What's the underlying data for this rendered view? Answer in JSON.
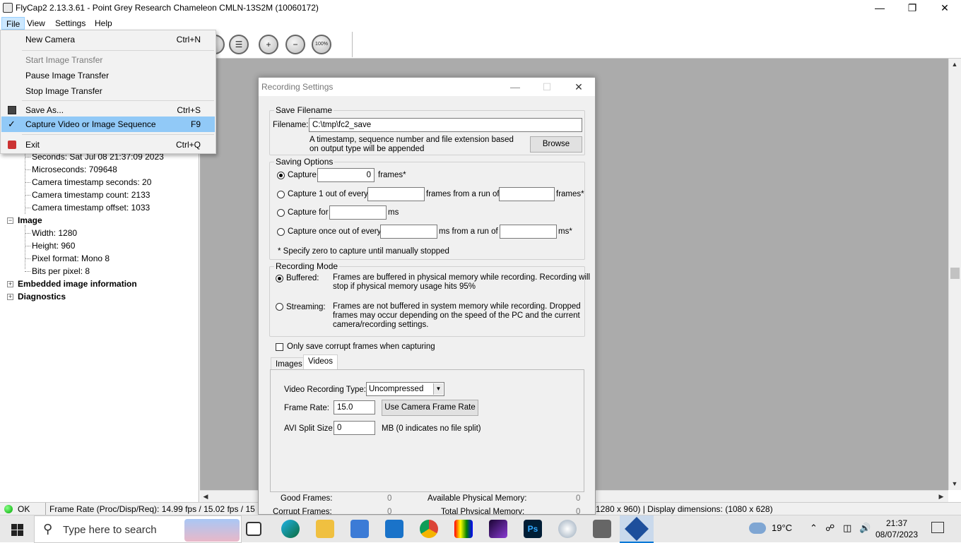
{
  "window": {
    "title": "FlyCap2 2.13.3.61 - Point Grey Research Chameleon CMLN-13S2M (10060172)"
  },
  "menubar": {
    "items": [
      "File",
      "View",
      "Settings",
      "Help"
    ]
  },
  "file_menu": {
    "new_camera": {
      "label": "New Camera",
      "shortcut": "Ctrl+N"
    },
    "start_transfer": {
      "label": "Start Image Transfer"
    },
    "pause_transfer": {
      "label": "Pause Image Transfer"
    },
    "stop_transfer": {
      "label": "Stop Image Transfer"
    },
    "save_as": {
      "label": "Save As...",
      "shortcut": "Ctrl+S"
    },
    "capture": {
      "label": "Capture Video or Image Sequence",
      "shortcut": "F9"
    },
    "exit": {
      "label": "Exit",
      "shortcut": "Ctrl+Q"
    }
  },
  "toolbar": {
    "zoom_100_label": "100%"
  },
  "tree": {
    "timestamp_items": [
      "Seconds: Sat Jul 08 21:37:09 2023",
      "Microseconds: 709648",
      "Camera timestamp seconds: 20",
      "Camera timestamp count:  2133",
      "Camera timestamp offset: 1033"
    ],
    "image_node": "Image",
    "image_items": [
      "Width: 1280",
      "Height: 960",
      "Pixel format: Mono 8",
      "Bits per pixel:  8"
    ],
    "embedded_node": "Embedded image information",
    "diagnostics_node": "Diagnostics"
  },
  "statusbar": {
    "ok": "OK",
    "frame_rate": "Frame Rate (Proc/Disp/Req): 14.99 fps / 15.02 fps / 15",
    "dimensions": "1280 x 960) | Display dimensions: (1080 x 628)"
  },
  "dialog": {
    "title": "Recording Settings",
    "save_filename": {
      "group_label": "Save Filename",
      "filename_label": "Filename:",
      "filename_value": "C:\\tmp\\fc2_save",
      "hint_line1": "A timestamp, sequence number and file extension based",
      "hint_line2": "on output type will be appended",
      "browse": "Browse"
    },
    "saving_options": {
      "group_label": "Saving Options",
      "capture_label": "Capture",
      "capture_value": "0",
      "frames_star": "frames*",
      "capture_1_of": "Capture 1 out of every",
      "frames_from_run": "frames from a run of",
      "frames_star2": "frames*",
      "capture_for": "Capture for",
      "ms": "ms",
      "capture_once": "Capture once out of every",
      "ms_from_run": "ms from a run of",
      "ms_star": "ms*",
      "note": "* Specify zero to capture until manually stopped"
    },
    "recording_mode": {
      "group_label": "Recording Mode",
      "buffered_label": "Buffered:",
      "buffered_desc1": "Frames are buffered in physical memory while recording. Recording will",
      "buffered_desc2": "stop if physical memory usage hits 95%",
      "streaming_label": "Streaming:",
      "streaming_desc1": "Frames are not buffered in system memory while recording. Dropped",
      "streaming_desc2": "frames may occur depending on the speed of the PC and the current",
      "streaming_desc3": "camera/recording settings."
    },
    "corrupt_only": "Only save corrupt frames when capturing",
    "tabs": {
      "images": "Images",
      "videos": "Videos"
    },
    "videos": {
      "type_label": "Video Recording Type:",
      "type_value": "Uncompressed",
      "frame_rate_label": "Frame Rate:",
      "frame_rate_value": "15.0",
      "use_camera_rate": "Use Camera Frame Rate",
      "split_label": "AVI Split Size:",
      "split_value": "0",
      "split_hint": "MB (0 indicates no file split)"
    },
    "stats": {
      "good_frames": "Good Frames:",
      "good_frames_value": "0",
      "available_mem": "Available Physical Memory:",
      "available_mem_value": "0",
      "corrupt_frames": "Corrupt Frames:",
      "corrupt_frames_value": "0",
      "total_mem": "Total Physical Memory:",
      "total_mem_value": "0"
    }
  },
  "taskbar": {
    "search_placeholder": "Type here to search",
    "weather": "19°C",
    "time": "21:37",
    "date": "08/07/2023"
  }
}
